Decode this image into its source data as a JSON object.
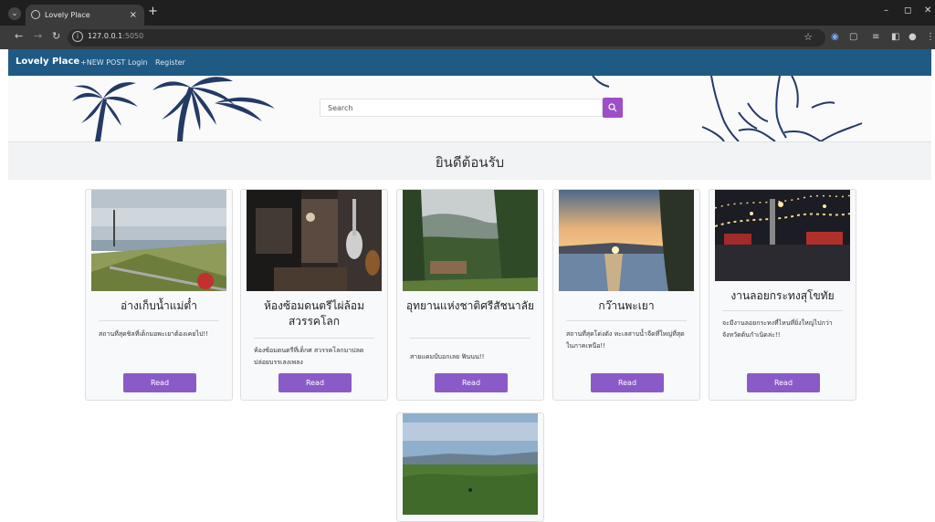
{
  "browser": {
    "tab_title": "Lovely Place",
    "tab_close": "×",
    "new_tab": "+",
    "url_host": "127.0.0.1",
    "url_port": ":5050",
    "window_min": "–",
    "window_max": "◻",
    "window_close": "✕"
  },
  "nav": {
    "brand": "Lovely Place",
    "new_post": "+NEW POST",
    "login": "Login",
    "register": "Register"
  },
  "hero": {
    "search_placeholder": "Search",
    "search_icon": "search-icon"
  },
  "welcome": "ยินดีต้อนรับ",
  "cards": [
    {
      "title": "อ่างเก็บน้ำแม่ต๋ำ",
      "desc": "สถานที่สุดชิลที่เด็กมอพะเยาต้องเคยไป!!",
      "read": "Read"
    },
    {
      "title": "ห้องซ้อมดนตรีไผ่ล้อมสวรรคโลก",
      "desc": "ห้องซ้อมดนตรีที่เด็กศ สวรรคโลกมาปลดปล่อยบรรเลงเพลง",
      "read": "Read"
    },
    {
      "title": "อุทยานแห่งชาติศรีสัชนาลัย",
      "desc": "สายแคมป์บอกเลย ฟินนน!!",
      "read": "Read"
    },
    {
      "title": "กว๊านพะเยา",
      "desc": "สถานที่สุดโด่งดัง ทะเลสาบน้ำจืดที่ใหญ่ที่สุดในภาคเหนือ!!",
      "read": "Read"
    },
    {
      "title": "งานลอยกระทงสุโขทัย",
      "desc": "จะมีงานลอยกระทงที่ไหนที่ยิ่งใหญ่ไปกว่าจังหวัดต้นกำเนิดล่ะ!!",
      "read": "Read"
    }
  ],
  "colors": {
    "navbar": "#1f5a85",
    "accent": "#8a5bc8",
    "search_button": "#9e4fc8",
    "palm": "#243a66"
  }
}
